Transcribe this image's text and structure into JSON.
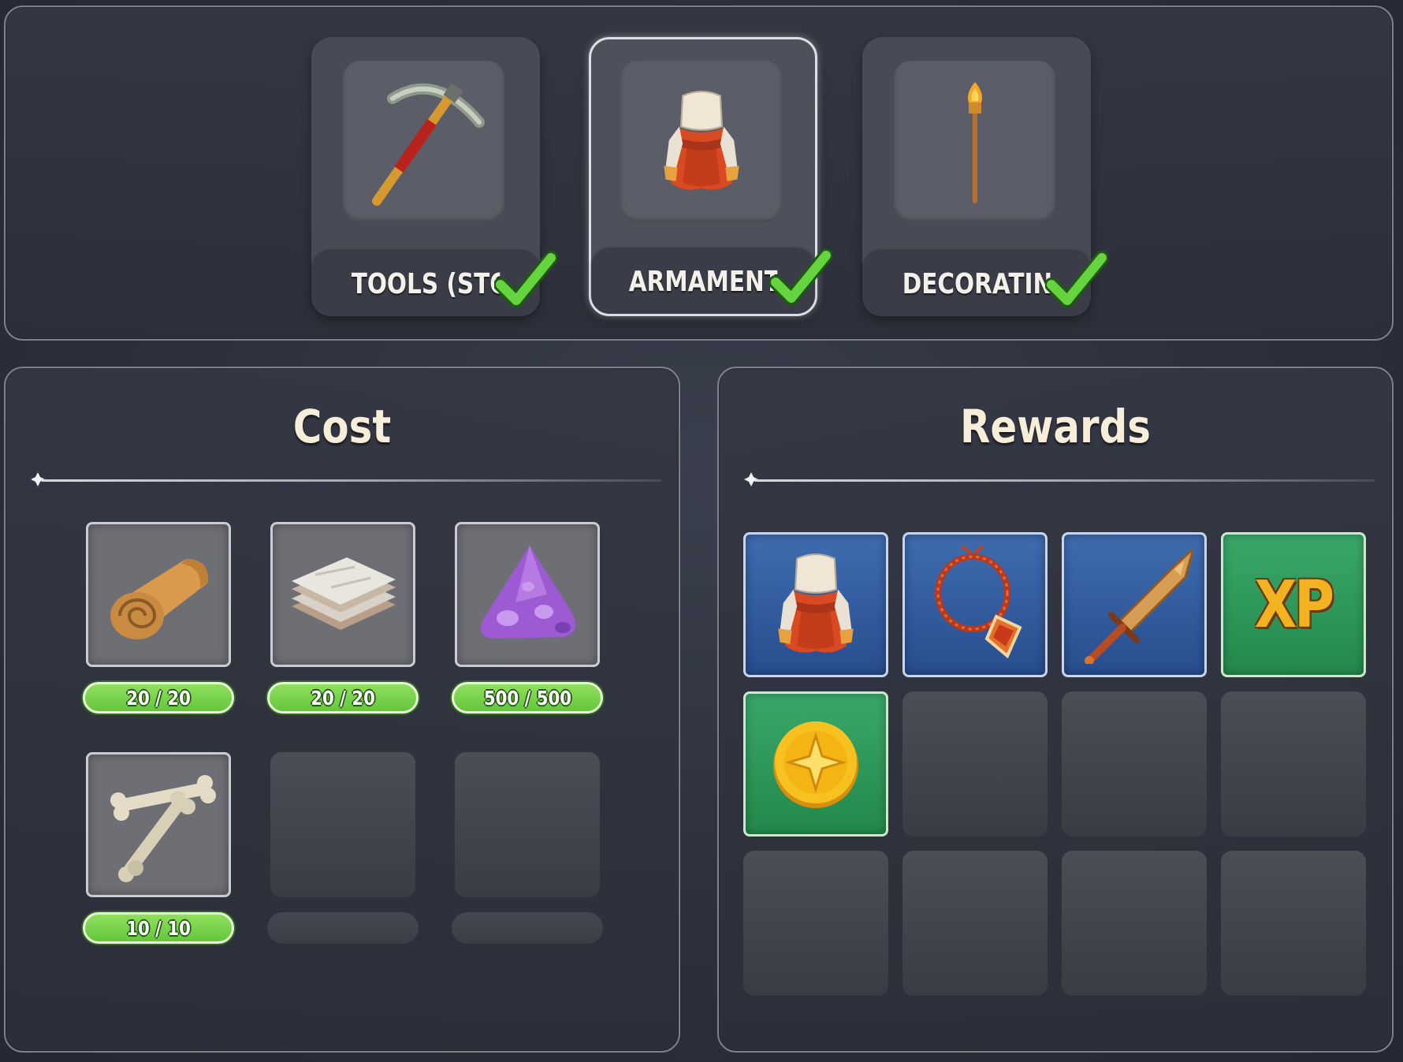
{
  "categories": [
    {
      "label": "TOOLS (STONE)",
      "icon": "pickaxe-icon",
      "completed": true,
      "selected": false
    },
    {
      "label": "ARMAMENT I",
      "icon": "armor-icon",
      "completed": true,
      "selected": true
    },
    {
      "label": "DECORATING I",
      "icon": "torch-icon",
      "completed": true,
      "selected": false
    }
  ],
  "cost": {
    "title": "Cost",
    "items": [
      {
        "icon": "leather-roll-icon",
        "progress": "20 / 20"
      },
      {
        "icon": "cloth-stack-icon",
        "progress": "20 / 20"
      },
      {
        "icon": "amethyst-ore-icon",
        "progress": "500 / 500"
      },
      {
        "icon": "bones-icon",
        "progress": "10 / 10"
      }
    ]
  },
  "rewards": {
    "title": "Rewards",
    "items": [
      {
        "icon": "armor-icon",
        "style": "blue"
      },
      {
        "icon": "amulet-icon",
        "style": "blue"
      },
      {
        "icon": "dagger-icon",
        "style": "blue"
      },
      {
        "icon": "xp-icon",
        "style": "green",
        "text": "XP"
      },
      {
        "icon": "coin-icon",
        "style": "green"
      }
    ]
  },
  "colors": {
    "check": "#5fcf3c",
    "progress_green": "#7fd64d",
    "reward_blue": "#3461a3",
    "reward_green": "#2f9a5a"
  }
}
